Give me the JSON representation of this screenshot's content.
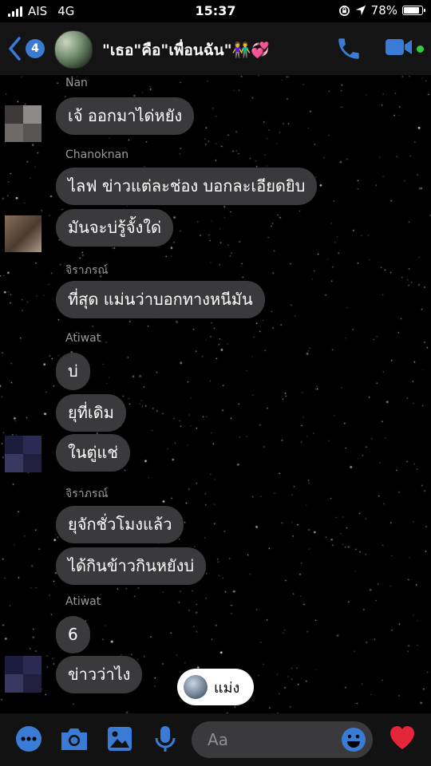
{
  "status_bar": {
    "carrier": "AIS",
    "network": "4G",
    "time": "15:37",
    "battery": "78%"
  },
  "header": {
    "back_count": "4",
    "group_name": "\"เธอ\"คือ\"เพื่อนฉัน\"👫💞"
  },
  "messages": [
    {
      "sender": "Nan",
      "bubbles": [
        "เจ้ ออกมาได่หยัง"
      ]
    },
    {
      "sender": "Chanoknan",
      "bubbles": [
        "ไลฟ ข่าวแต่ละช่อง  บอกละเอียดยิบ",
        "มันจะบ่รู้จั้งใด่"
      ]
    },
    {
      "sender": "จิราภรณ์",
      "bubbles": [
        "ที่สุด แม่นว่าบอกทางหนีมัน"
      ]
    },
    {
      "sender": "Atiwat",
      "bubbles": [
        "บ่",
        "ยุที่เดิม",
        "ในตู่แช่"
      ]
    },
    {
      "sender": "จิราภรณ์",
      "bubbles": [
        "ยุจักชั่วโมงแล้ว",
        "ได้กินข้าวกินหยังบ่"
      ]
    },
    {
      "sender": "Atiwat",
      "bubbles": [
        "6",
        "ข่าวว่าไง"
      ]
    }
  ],
  "typing_indicator": {
    "name": "แม่ง"
  },
  "composer": {
    "placeholder": "Aa"
  },
  "icons": {
    "back": "chevron-left-icon",
    "call": "phone-icon",
    "video": "video-camera-icon",
    "more": "more-dots-icon",
    "camera": "camera-icon",
    "gallery": "image-icon",
    "mic": "microphone-icon",
    "emoji": "emoji-icon",
    "like": "heart-icon"
  },
  "colors": {
    "accent": "#1877F2",
    "bubble": "#3a3a3c",
    "background": "#000000",
    "heart": "#e5253a",
    "online": "#2ecc40"
  }
}
